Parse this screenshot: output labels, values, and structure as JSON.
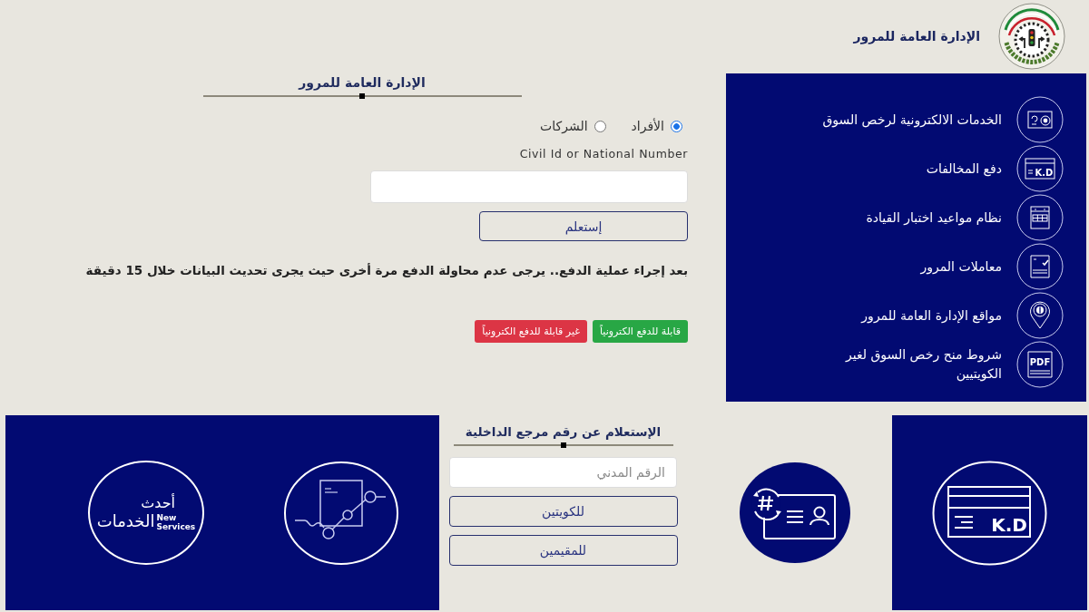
{
  "header": {
    "title": "الإدارة العامة للمرور"
  },
  "inquiry_form": {
    "heading": "الإدارة العامة للمرور",
    "options": [
      {
        "label": "الأفراد",
        "selected": true
      },
      {
        "label": "الشركات",
        "selected": false
      }
    ],
    "field_label": "Civil Id or National Number",
    "submit": "إستعلم",
    "notice": "بعد إجراء عملية الدفع.. يرجى عدم محاولة الدفع مرة أخرى حيث يجرى تحديث البيانات خلال 15 دقيقة",
    "legend": [
      {
        "label": "قابلة للدفع الكترونياً",
        "color": "#28a745"
      },
      {
        "label": "غير قابلة للدفع الكترونياً",
        "color": "#dc3545"
      }
    ]
  },
  "services_menu": [
    {
      "kind": "license",
      "label": "الخدمات الالكترونية لرخص السوق"
    },
    {
      "kind": "payment",
      "label": "دفع المخالفات",
      "icon_text": "K.D"
    },
    {
      "kind": "calendar",
      "label": "نظام مواعيد اختبار القيادة"
    },
    {
      "kind": "checklist",
      "label": "معاملات المرور"
    },
    {
      "kind": "location",
      "label": "مواقع الإدارة العامة للمرور"
    },
    {
      "kind": "pdf",
      "label": "شروط منح رخص السوق لغير الكويتيين",
      "icon_text": "PDF"
    }
  ],
  "new_services_emblem": {
    "arabic_top": "أحدث",
    "arabic_bottom": "الخدمات",
    "english": [
      "New",
      "Services"
    ]
  },
  "reference_inquiry": {
    "heading": "الإستعلام عن رقم مرجع الداخلية",
    "placeholder": "الرقم المدني",
    "buttons": [
      "للكويتين",
      "للمقيمين"
    ]
  },
  "fines_payment_tile": {
    "card_text": "K.D"
  }
}
